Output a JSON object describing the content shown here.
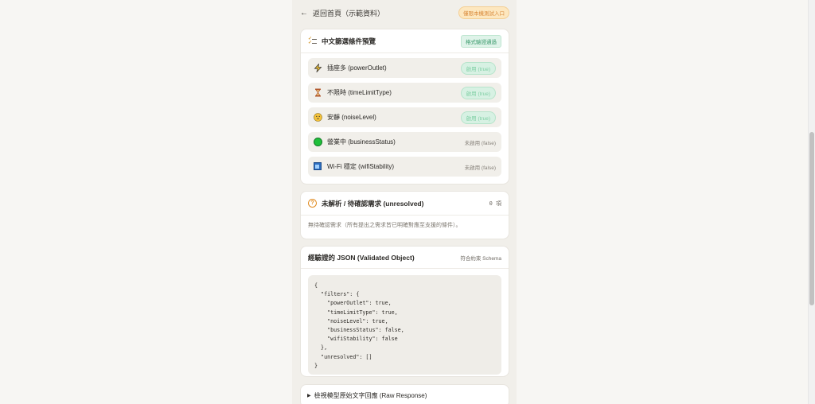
{
  "topbar": {
    "back_label": "返回首頁（示範資料）",
    "badge": "僅限本機測試入口"
  },
  "filters_card": {
    "title": "中文篩選條件預覽",
    "badge": "格式驗證通過",
    "items": [
      {
        "icon": "lightning-icon",
        "label": "插座多 (powerOutlet)",
        "status": "啟用 (true)",
        "enabled": true
      },
      {
        "icon": "hourglass-icon",
        "label": "不限時 (timeLimitType)",
        "status": "啟用 (true)",
        "enabled": true
      },
      {
        "icon": "quiet-face-icon",
        "label": "安靜 (noiseLevel)",
        "status": "啟用 (true)",
        "enabled": true
      },
      {
        "icon": "green-circle-icon",
        "label": "營業中 (businessStatus)",
        "status": "未啟用 (false)",
        "enabled": false
      },
      {
        "icon": "wifi-signal-icon",
        "label": "Wi-Fi 穩定 (wifiStability)",
        "status": "未啟用 (false)",
        "enabled": false
      }
    ]
  },
  "unresolved_card": {
    "title": "未解析 / 待確認需求 (unresolved)",
    "count": "0 項",
    "message": "無待確認需求（所有提出之需求皆已明確對應至支援的條件）。"
  },
  "json_card": {
    "title": "經驗證的 JSON (Validated Object)",
    "note": "符合約束 Schema",
    "code": "{\n  \"filters\": {\n    \"powerOutlet\": true,\n    \"timeLimitType\": true,\n    \"noiseLevel\": true,\n    \"businessStatus\": false,\n    \"wifiStability\": false\n  },\n  \"unresolved\": []\n}"
  },
  "raw_response": {
    "label": "檢視模型原始文字回應 (Raw Response)"
  },
  "colors": {
    "accent_green": "#3a9a6c",
    "accent_orange": "#d8893a",
    "background": "#f7f6f3"
  }
}
